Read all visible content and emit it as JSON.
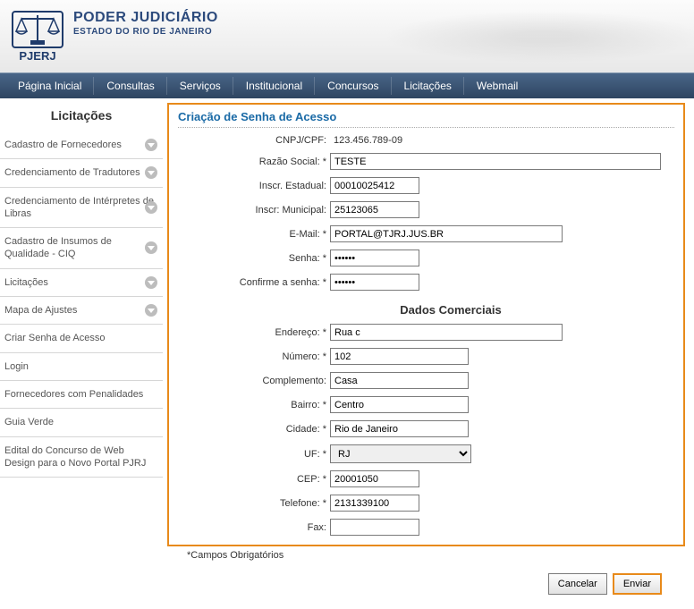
{
  "header": {
    "line1": "PODER JUDICIÁRIO",
    "line2": "ESTADO DO RIO DE JANEIRO",
    "logo_sub": "PJERJ"
  },
  "nav": [
    "Página Inicial",
    "Consultas",
    "Serviços",
    "Institucional",
    "Concursos",
    "Licitações",
    "Webmail"
  ],
  "sidebar": {
    "title": "Licitações",
    "items": [
      {
        "label": "Cadastro de Fornecedores",
        "expandable": true
      },
      {
        "label": "Credenciamento de Tradutores",
        "expandable": true
      },
      {
        "label": "Credenciamento de Intérpretes de Libras",
        "expandable": true
      },
      {
        "label": "Cadastro de Insumos de Qualidade - CIQ",
        "expandable": true
      },
      {
        "label": "Licitações",
        "expandable": true
      },
      {
        "label": "Mapa de Ajustes",
        "expandable": true
      },
      {
        "label": "Criar Senha de Acesso",
        "expandable": false
      },
      {
        "label": "Login",
        "expandable": false
      },
      {
        "label": "Fornecedores com Penalidades",
        "expandable": false
      },
      {
        "label": "Guia Verde",
        "expandable": false
      },
      {
        "label": "Edital do Concurso de Web Design para o Novo Portal PJRJ",
        "expandable": false
      }
    ]
  },
  "form": {
    "title": "Criação de Senha de Acesso",
    "section_title": "Dados Comerciais",
    "footnote": "*Campos Obrigatórios",
    "labels": {
      "cnpj": "CNPJ/CPF:",
      "razao": "Razão Social: *",
      "insc_est": "Inscr. Estadual:",
      "insc_mun": "Inscr: Municipal:",
      "email": "E-Mail: *",
      "senha": "Senha: *",
      "confirma": "Confirme a senha: *",
      "endereco": "Endereço: *",
      "numero": "Número: *",
      "complemento": "Complemento:",
      "bairro": "Bairro: *",
      "cidade": "Cidade: *",
      "uf": "UF: *",
      "cep": "CEP: *",
      "telefone": "Telefone: *",
      "fax": "Fax:"
    },
    "values": {
      "cnpj": "123.456.789-09",
      "razao": "TESTE",
      "insc_est": "00010025412",
      "insc_mun": "25123065",
      "email": "PORTAL@TJRJ.JUS.BR",
      "senha": "••••••",
      "confirma": "••••••",
      "endereco": "Rua c",
      "numero": "102",
      "complemento": "Casa",
      "bairro": "Centro",
      "cidade": "Rio de Janeiro",
      "uf": "RJ",
      "cep": "20001050",
      "telefone": "2131339100",
      "fax": ""
    },
    "buttons": {
      "cancel": "Cancelar",
      "submit": "Enviar"
    }
  }
}
